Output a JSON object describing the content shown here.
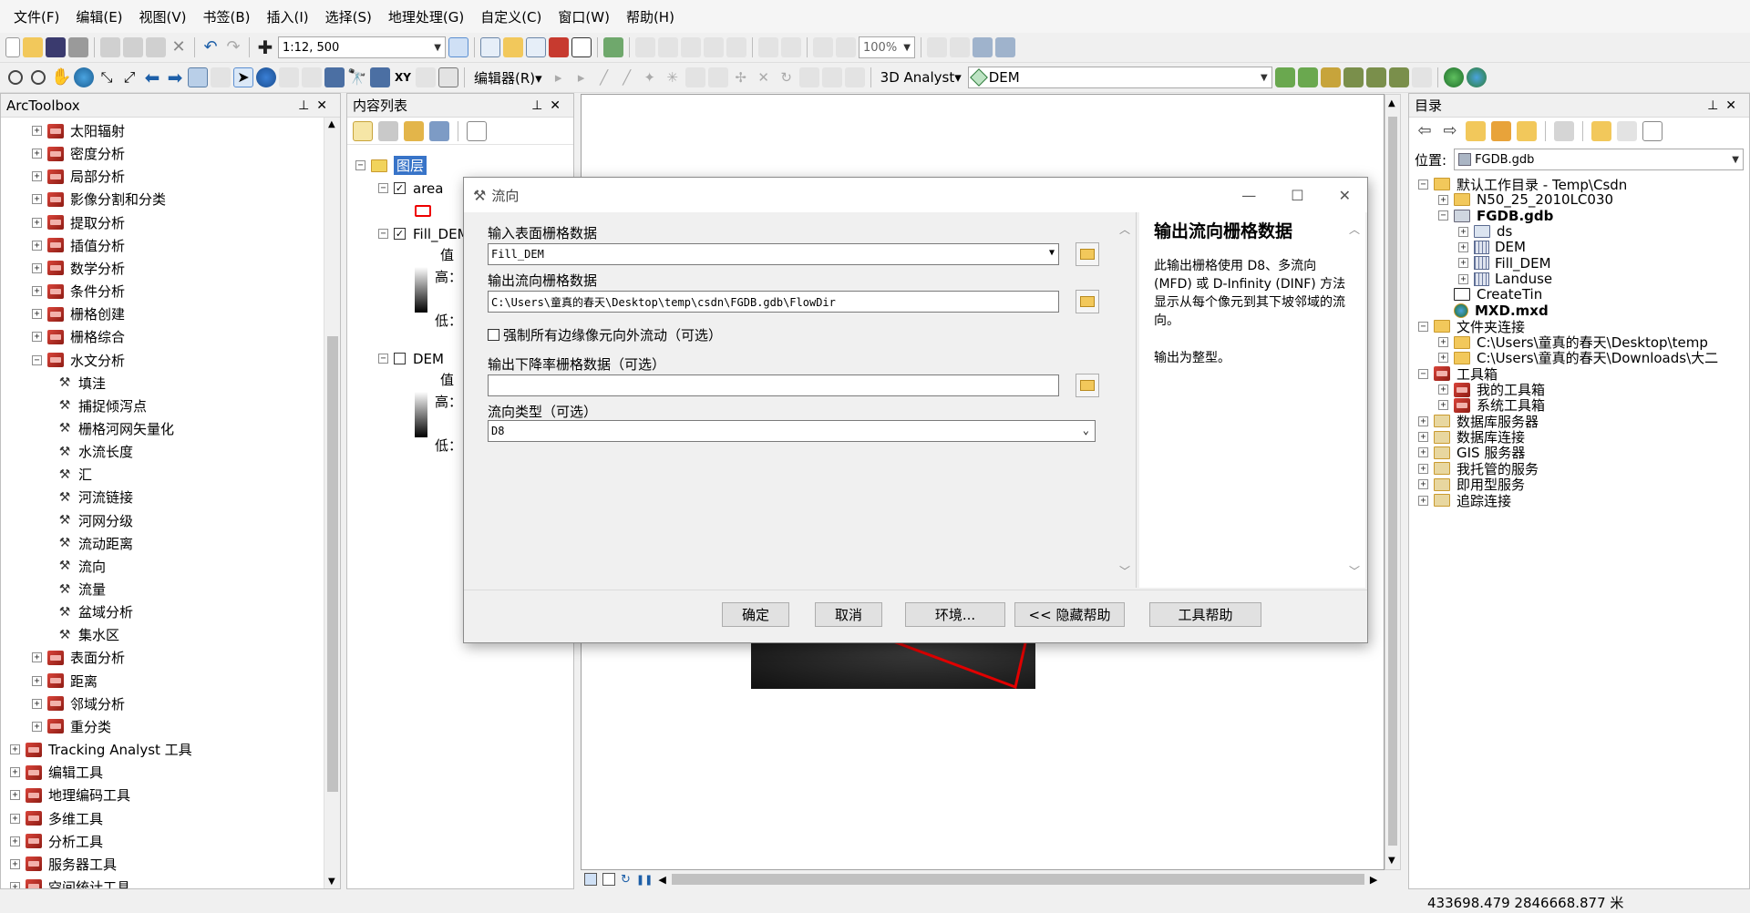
{
  "menu": [
    "文件(F)",
    "编辑(E)",
    "视图(V)",
    "书签(B)",
    "插入(I)",
    "选择(S)",
    "地理处理(G)",
    "自定义(C)",
    "窗口(W)",
    "帮助(H)"
  ],
  "toolbar": {
    "scale": "1:12, 500",
    "zoom": "100%",
    "editor_label": "编辑器(R)▾",
    "analyst_label": "3D Analyst▾",
    "layer_combo": "DEM"
  },
  "arctoolbox": {
    "title": "ArcToolbox",
    "items": [
      {
        "label": "太阳辐射",
        "kind": "toolset",
        "level": 1,
        "pm": "+"
      },
      {
        "label": "密度分析",
        "kind": "toolset",
        "level": 1,
        "pm": "+"
      },
      {
        "label": "局部分析",
        "kind": "toolset",
        "level": 1,
        "pm": "+"
      },
      {
        "label": "影像分割和分类",
        "kind": "toolset",
        "level": 1,
        "pm": "+"
      },
      {
        "label": "提取分析",
        "kind": "toolset",
        "level": 1,
        "pm": "+"
      },
      {
        "label": "插值分析",
        "kind": "toolset",
        "level": 1,
        "pm": "+"
      },
      {
        "label": "数学分析",
        "kind": "toolset",
        "level": 1,
        "pm": "+"
      },
      {
        "label": "条件分析",
        "kind": "toolset",
        "level": 1,
        "pm": "+"
      },
      {
        "label": "栅格创建",
        "kind": "toolset",
        "level": 1,
        "pm": "+"
      },
      {
        "label": "栅格综合",
        "kind": "toolset",
        "level": 1,
        "pm": "+"
      },
      {
        "label": "水文分析",
        "kind": "toolset",
        "level": 1,
        "pm": "−"
      },
      {
        "label": "填洼",
        "kind": "tool",
        "level": 2
      },
      {
        "label": "捕捉倾泻点",
        "kind": "tool",
        "level": 2
      },
      {
        "label": "栅格河网矢量化",
        "kind": "tool",
        "level": 2
      },
      {
        "label": "水流长度",
        "kind": "tool",
        "level": 2
      },
      {
        "label": "汇",
        "kind": "tool",
        "level": 2
      },
      {
        "label": "河流链接",
        "kind": "tool",
        "level": 2
      },
      {
        "label": "河网分级",
        "kind": "tool",
        "level": 2
      },
      {
        "label": "流动距离",
        "kind": "tool",
        "level": 2
      },
      {
        "label": "流向",
        "kind": "tool",
        "level": 2
      },
      {
        "label": "流量",
        "kind": "tool",
        "level": 2
      },
      {
        "label": "盆域分析",
        "kind": "tool",
        "level": 2
      },
      {
        "label": "集水区",
        "kind": "tool",
        "level": 2
      },
      {
        "label": "表面分析",
        "kind": "toolset",
        "level": 1,
        "pm": "+"
      },
      {
        "label": "距离",
        "kind": "toolset",
        "level": 1,
        "pm": "+"
      },
      {
        "label": "邻域分析",
        "kind": "toolset",
        "level": 1,
        "pm": "+"
      },
      {
        "label": "重分类",
        "kind": "toolset",
        "level": 1,
        "pm": "+"
      },
      {
        "label": "Tracking Analyst 工具",
        "kind": "toolbox",
        "level": 0,
        "pm": "+"
      },
      {
        "label": "编辑工具",
        "kind": "toolbox",
        "level": 0,
        "pm": "+"
      },
      {
        "label": "地理编码工具",
        "kind": "toolbox",
        "level": 0,
        "pm": "+"
      },
      {
        "label": "多维工具",
        "kind": "toolbox",
        "level": 0,
        "pm": "+"
      },
      {
        "label": "分析工具",
        "kind": "toolbox",
        "level": 0,
        "pm": "+"
      },
      {
        "label": "服务器工具",
        "kind": "toolbox",
        "level": 0,
        "pm": "+"
      },
      {
        "label": "空间统计工具",
        "kind": "toolbox",
        "level": 0,
        "pm": "+"
      }
    ]
  },
  "toc": {
    "title": "内容列表",
    "root": "图层",
    "layer1": "area",
    "layer2": "Fill_DEM",
    "layer3": "DEM",
    "value_label": "值",
    "high_label": "高：",
    "low_label": "低："
  },
  "dialog": {
    "title": "流向",
    "input_label": "输入表面栅格数据",
    "input_value": "Fill_DEM",
    "output_label": "输出流向栅格数据",
    "output_value": "C:\\Users\\童真的春天\\Desktop\\temp\\csdn\\FGDB.gdb\\FlowDir",
    "force_edge_label": "强制所有边缘像元向外流动（可选）",
    "drop_label": "输出下降率栅格数据（可选）",
    "drop_value": "",
    "flow_type_label": "流向类型（可选）",
    "flow_type_value": "D8",
    "help_title": "输出流向栅格数据",
    "help_text": "此输出栅格使用 D8、多流向 (MFD) 或 D-Infinity (DINF) 方法显示从每个像元到其下坡邻域的流向。",
    "help_text2": "输出为整型。",
    "ok": "确定",
    "cancel": "取消",
    "env": "环境...",
    "hide_help": "<< 隐藏帮助",
    "tool_help": "工具帮助"
  },
  "catalog": {
    "title": "目录",
    "location_label": "位置:",
    "location_value": "FGDB.gdb",
    "items": [
      {
        "label": "默认工作目录 - Temp\\Csdn",
        "level": 0,
        "pm": "−",
        "icon": "folder"
      },
      {
        "label": "N50_25_2010LC030",
        "level": 1,
        "pm": "+",
        "icon": "folder"
      },
      {
        "label": "FGDB.gdb",
        "level": 1,
        "pm": "−",
        "icon": "gdb",
        "bold": true
      },
      {
        "label": "ds",
        "level": 2,
        "pm": "+",
        "icon": "ds"
      },
      {
        "label": "DEM",
        "level": 2,
        "pm": "+",
        "icon": "grid"
      },
      {
        "label": "Fill_DEM",
        "level": 2,
        "pm": "+",
        "icon": "grid"
      },
      {
        "label": "Landuse",
        "level": 2,
        "pm": "+",
        "icon": "grid"
      },
      {
        "label": "CreateTin",
        "level": 1,
        "pm": "",
        "icon": "tin"
      },
      {
        "label": "MXD.mxd",
        "level": 1,
        "pm": "",
        "icon": "mxd",
        "bold": true
      },
      {
        "label": "文件夹连接",
        "level": 0,
        "pm": "−",
        "icon": "folder"
      },
      {
        "label": "C:\\Users\\童真的春天\\Desktop\\temp",
        "level": 1,
        "pm": "+",
        "icon": "folder"
      },
      {
        "label": "C:\\Users\\童真的春天\\Downloads\\大二",
        "level": 1,
        "pm": "+",
        "icon": "folder"
      },
      {
        "label": "工具箱",
        "level": 0,
        "pm": "−",
        "icon": "toolbox"
      },
      {
        "label": "我的工具箱",
        "level": 1,
        "pm": "+",
        "icon": "toolbox"
      },
      {
        "label": "系统工具箱",
        "level": 1,
        "pm": "+",
        "icon": "toolbox"
      },
      {
        "label": "数据库服务器",
        "level": 0,
        "pm": "+",
        "icon": "server"
      },
      {
        "label": "数据库连接",
        "level": 0,
        "pm": "+",
        "icon": "server"
      },
      {
        "label": "GIS 服务器",
        "level": 0,
        "pm": "+",
        "icon": "server"
      },
      {
        "label": "我托管的服务",
        "level": 0,
        "pm": "+",
        "icon": "server"
      },
      {
        "label": "即用型服务",
        "level": 0,
        "pm": "+",
        "icon": "server"
      },
      {
        "label": "追踪连接",
        "level": 0,
        "pm": "+",
        "icon": "server"
      }
    ]
  },
  "status": {
    "coords": "433698.479  2846668.877 米"
  }
}
